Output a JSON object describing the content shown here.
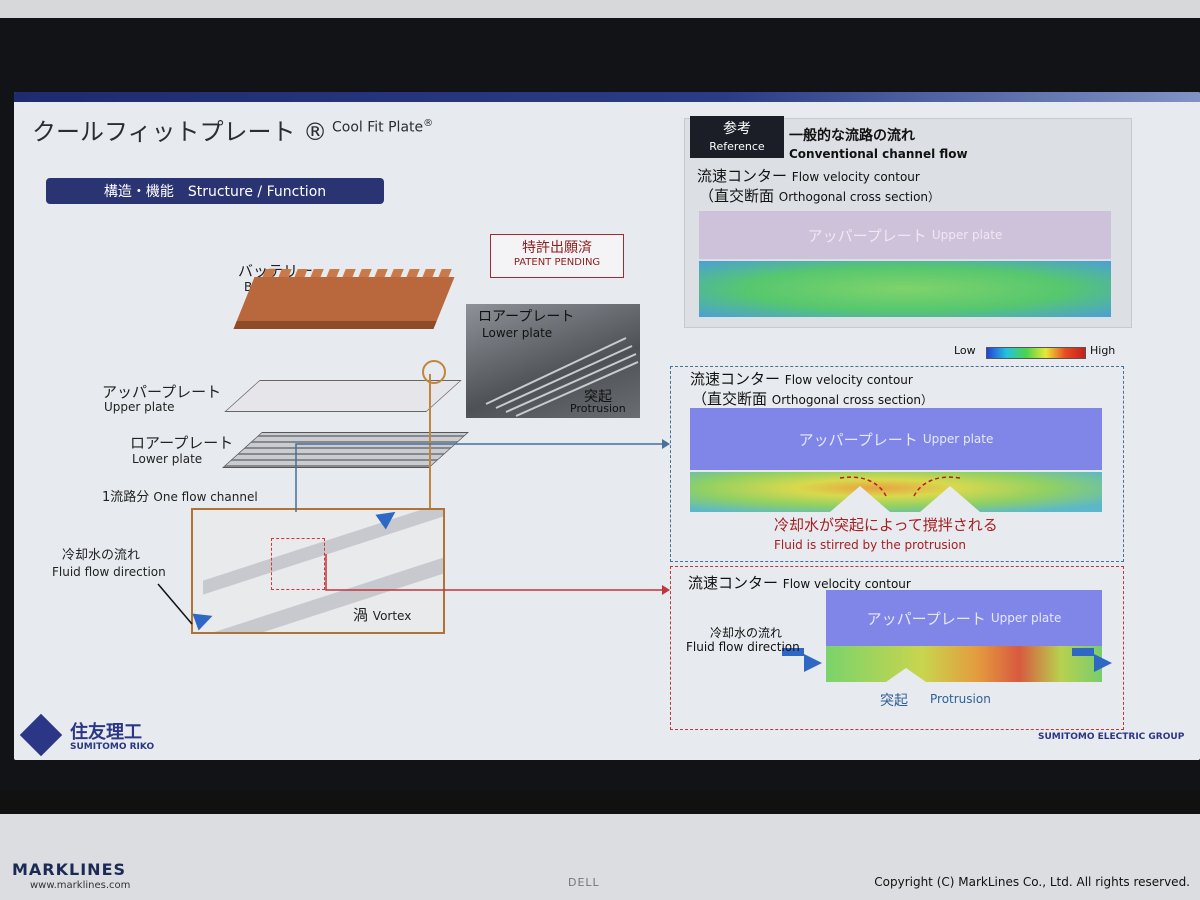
{
  "slide": {
    "title_ja": "クールフィットプレート ®",
    "title_en": "Cool Fit Plate",
    "title_en_mark": "®",
    "section": "構造・機能　Structure / Function",
    "patent": {
      "ja": "特許出願済",
      "en": "PATENT PENDING"
    },
    "left": {
      "battery_ja": "バッテリー",
      "battery_en": "Battery",
      "upper_ja": "アッパープレート",
      "upper_en": "Upper plate",
      "lower_ja": "ロアープレート",
      "lower_en": "Lower plate",
      "channel": "1流路分",
      "channel_en": "One flow channel",
      "fluid_ja": "冷却水の流れ",
      "fluid_en": "Fluid flow direction",
      "vortex_ja": "渦",
      "vortex_en": "Vortex"
    },
    "photo": {
      "lower_ja": "ロアープレート",
      "lower_en": "Lower plate",
      "protrusion_ja": "突起",
      "protrusion_en": "Protrusion"
    },
    "reference": {
      "tag_ja": "参考",
      "tag_en": "Reference",
      "heading_ja": "一般的な流路の流れ",
      "heading_en": "Conventional channel flow",
      "contour_ja": "流速コンター",
      "contour_en": "Flow velocity contour",
      "section_ja": "（直交断面",
      "section_en": "Orthogonal cross section）",
      "upper_ja": "アッパープレート",
      "upper_en": "Upper plate"
    },
    "legend": {
      "low": "Low",
      "high": "High"
    },
    "contour1": {
      "title_ja": "流速コンター",
      "title_en": "Flow velocity contour",
      "section_ja": "（直交断面",
      "section_en": "Orthogonal cross section）",
      "upper_ja": "アッパープレート",
      "upper_en": "Upper plate",
      "caption_ja": "冷却水が突起によって撹拌される",
      "caption_en": "Fluid is stirred by the protrusion"
    },
    "contour2": {
      "title_ja": "流速コンター",
      "title_en": "Flow velocity contour",
      "upper_ja": "アッパープレート",
      "upper_en": "Upper plate",
      "fluid_ja": "冷却水の流れ",
      "fluid_en": "Fluid flow direction",
      "protrusion_ja": "突起",
      "protrusion_en": "Protrusion"
    },
    "logo_ja": "住友理工",
    "logo_en": "SUMITOMO RIKO",
    "group": "SUMITOMO ELECTRIC GROUP"
  },
  "watermark": {
    "brand": "MARKLINES",
    "url": "www.marklines.com",
    "copyright": "Copyright (C) MarkLines Co., Ltd. All rights reserved.",
    "monitor_brand": "DELL"
  },
  "colors": {
    "navy": "#2b3473",
    "accent_red": "#c0363b",
    "accent_blue": "#47709a",
    "copper": "#b9673d"
  }
}
